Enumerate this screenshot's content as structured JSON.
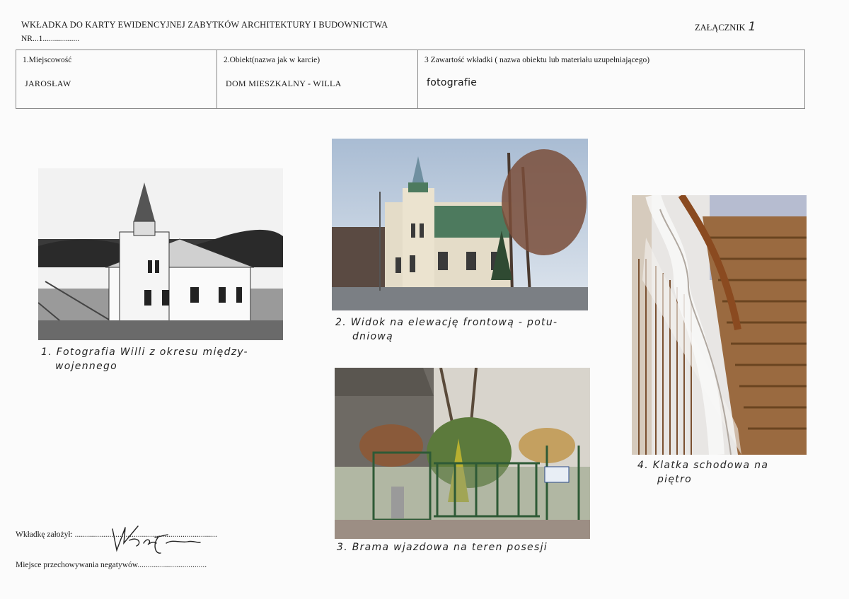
{
  "header": {
    "title": "WKŁADKA DO KARTY EWIDENCYJNEJ ZABYTKÓW ARCHITEKTURY I BUDOWNICTWA",
    "nr": "NR...1..................",
    "attachment_label": "ZAŁĄCZNIK",
    "attachment_number": "1"
  },
  "info_table": {
    "col1_label": "1.Miejscowość",
    "col1_value": "JAROSŁAW",
    "col2_label": "2.Obiekt(nazwa jak w karcie)",
    "col2_value": "DOM  MIESZKALNY - WILLA",
    "col3_label": "3 Zawartość wkładki ( nazwa obiektu lub materiału uzupełniającego)",
    "col3_value": "fotografie"
  },
  "captions": {
    "photo1_line1": "1. Fotografia Willi z okresu między-",
    "photo1_line2": "wojennego",
    "photo2_line1": "2. Widok na elewację frontową - potu-",
    "photo2_line2": "dniową",
    "photo3": "3. Brama wjazdowa na teren posesji",
    "photo4_line1": "4. Klatka schodowa na",
    "photo4_line2": "piętro"
  },
  "footer": {
    "created_by": "Wkładkę założył: ......................................................................",
    "negatives": "Miejsce przechowywania negatywów.................................."
  },
  "colors": {
    "text": "#1a1a1a",
    "border": "#8a8a8a",
    "paper": "#fbfbfb"
  },
  "icons": {
    "signature": "handwritten-signature"
  }
}
